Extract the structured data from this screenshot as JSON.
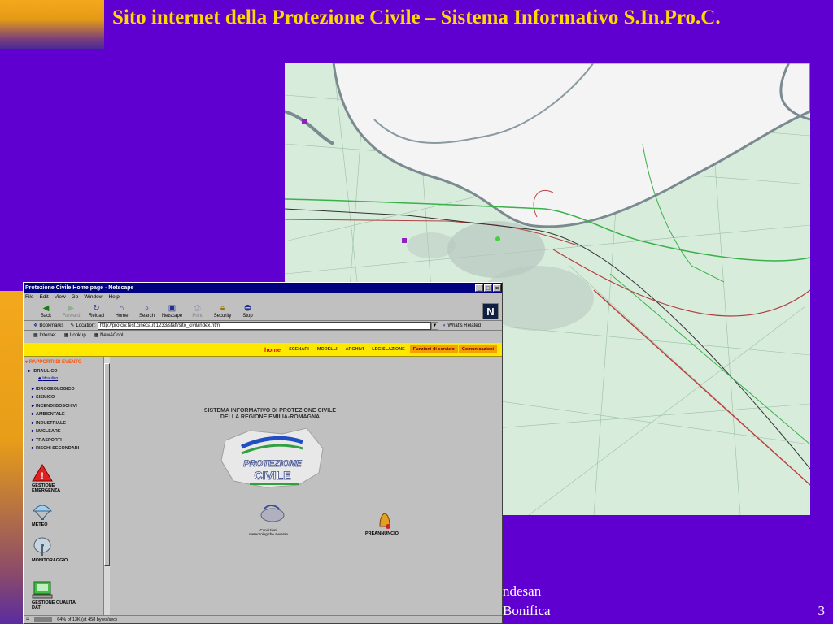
{
  "slide": {
    "title": "Sito internet della Protezione Civile – Sistema Informativo S.In.Pro.C.",
    "footer_line1": "ndesan",
    "footer_line2": "Bonifica",
    "page_number": "3"
  },
  "browser": {
    "window_title": "Protezione Civile Home page - Netscape",
    "menus": [
      "File",
      "Edit",
      "View",
      "Go",
      "Window",
      "Help"
    ],
    "toolbar": [
      {
        "label": "Back",
        "icon": "back-arrow-icon",
        "enabled": true
      },
      {
        "label": "Forward",
        "icon": "forward-arrow-icon",
        "enabled": false
      },
      {
        "label": "Reload",
        "icon": "reload-icon",
        "enabled": true
      },
      {
        "label": "Home",
        "icon": "home-icon",
        "enabled": true
      },
      {
        "label": "Search",
        "icon": "search-icon",
        "enabled": true
      },
      {
        "label": "Netscape",
        "icon": "netscape-icon",
        "enabled": true
      },
      {
        "label": "Print",
        "icon": "print-icon",
        "enabled": false
      },
      {
        "label": "Security",
        "icon": "security-icon",
        "enabled": true
      },
      {
        "label": "Stop",
        "icon": "stop-icon",
        "enabled": true
      }
    ],
    "location_label": "Location:",
    "bookmarks_label": "Bookmarks",
    "url": "http://protciv.test.cineca.it:1233/staff/sito_civil/index.htm",
    "whats_related": "What's Related",
    "personal_links": [
      "Internet",
      "Lookup",
      "New&Cool"
    ],
    "status": "64% of 13K (at 458 bytes/sec)"
  },
  "site": {
    "nav": {
      "home": "home",
      "items": [
        "SCENARI",
        "MODELLI",
        "ARCHIVI",
        "LEGISLAZIONE"
      ],
      "servizio": "Funzioni di servizio",
      "comunicazioni": "Comunicazioni"
    },
    "sidebar": {
      "heading": "RAPPORTI DI EVENTO",
      "expanded": "IDRAULICO",
      "sub_item": "Idraulico",
      "items": [
        "IDROGEOLOGICO",
        "SISMICO",
        "INCENDI BOSCHIVI",
        "AMBIENTALE",
        "INDUSTRIALE",
        "NUCLEARE",
        "TRASPORTI",
        "RISCHI SECONDARI"
      ],
      "icons": [
        {
          "label": "GESTIONE EMERGENZA",
          "icon": "warning-triangle-icon"
        },
        {
          "label": "METEO",
          "icon": "parachute-icon"
        },
        {
          "label": "MONITORAGGIO",
          "icon": "satellite-dish-icon"
        },
        {
          "label": "GESTIONE QUALITA' DATI",
          "icon": "computer-icon"
        }
      ]
    },
    "heading_line1": "SISTEMA INFORMATIVO DI PROTEZIONE CIVILE",
    "heading_line2": "DELLA REGIONE EMILIA-ROMAGNA",
    "logo_line1": "PROTEZIONE",
    "logo_line2": "CIVILE",
    "cond_label": "Condizioni meteorologiche avverse",
    "preannuncio": "PREANNUNCIO"
  },
  "colors": {
    "background": "#6000d0",
    "title": "#ffd800",
    "nav_yellow": "#ffe800",
    "nav_orange": "#f5a000",
    "map_land": "#d8ecdc",
    "map_river": "#f4f4f4"
  }
}
